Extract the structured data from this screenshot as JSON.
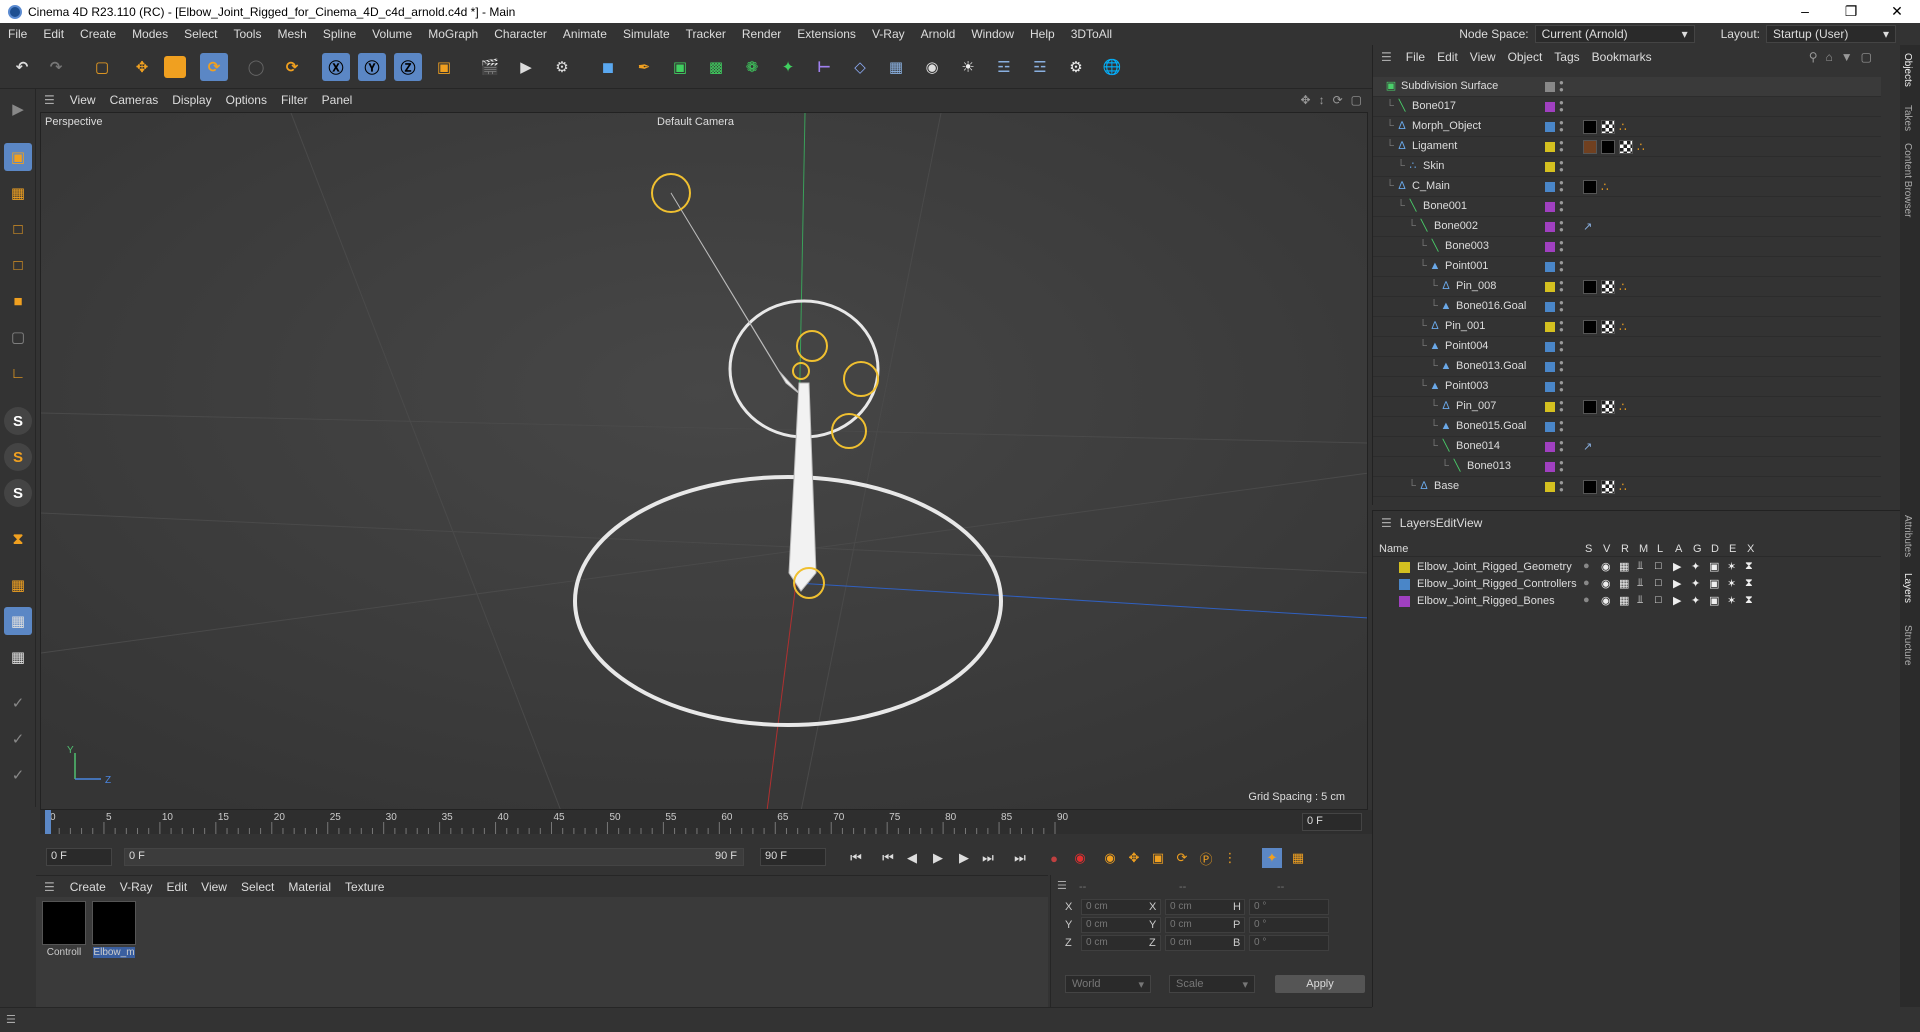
{
  "window": {
    "title": "Cinema 4D R23.110 (RC) - [Elbow_Joint_Rigged_for_Cinema_4D_c4d_arnold.c4d *] - Main"
  },
  "menu": {
    "items": [
      "File",
      "Edit",
      "Create",
      "Modes",
      "Select",
      "Tools",
      "Mesh",
      "Spline",
      "Volume",
      "MoGraph",
      "Character",
      "Animate",
      "Simulate",
      "Tracker",
      "Render",
      "Extensions",
      "V-Ray",
      "Arnold",
      "Window",
      "Help",
      "3DToAll"
    ],
    "node_space_label": "Node Space:",
    "node_space_value": "Current (Arnold)",
    "layout_label": "Layout:",
    "layout_value": "Startup (User)"
  },
  "viewport_menu": [
    "View",
    "Cameras",
    "Display",
    "Options",
    "Filter",
    "Panel"
  ],
  "viewport": {
    "label": "Perspective",
    "camera": "Default Camera",
    "grid_spacing": "Grid Spacing : 5 cm",
    "axis_y": "Y",
    "axis_z": "Z"
  },
  "timeline": {
    "ticks": [
      "0",
      "5",
      "10",
      "15",
      "20",
      "25",
      "30",
      "35",
      "40",
      "45",
      "50",
      "55",
      "60",
      "65",
      "70",
      "75",
      "80",
      "85",
      "90"
    ],
    "current_frame": "0 F",
    "start_field": "0 F",
    "range_start": "0 F",
    "range_end": "90 F",
    "end_field": "90 F",
    "right_field": "0 F"
  },
  "material_menu": [
    "Create",
    "V-Ray",
    "Edit",
    "View",
    "Select",
    "Material",
    "Texture"
  ],
  "materials": [
    {
      "name": "Controll"
    },
    {
      "name": "Elbow_m"
    }
  ],
  "coords": {
    "headers": [
      "--",
      "--",
      "--"
    ],
    "rows": [
      {
        "a": "X",
        "av": "0 cm",
        "b": "X",
        "bv": "0 cm",
        "c": "H",
        "cv": "0 °"
      },
      {
        "a": "Y",
        "av": "0 cm",
        "b": "Y",
        "bv": "0 cm",
        "c": "P",
        "cv": "0 °"
      },
      {
        "a": "Z",
        "av": "0 cm",
        "b": "Z",
        "bv": "0 cm",
        "c": "B",
        "cv": "0 °"
      }
    ],
    "world": "World",
    "scale": "Scale",
    "apply": "Apply"
  },
  "object_manager": {
    "menu": [
      "File",
      "Edit",
      "View",
      "Object",
      "Tags",
      "Bookmarks"
    ],
    "objects": [
      {
        "name": "Subdivision Surface",
        "depth": 0,
        "icon": "subdivision-icon",
        "color": "#4ad06a",
        "layer": "#888888"
      },
      {
        "name": "Bone017",
        "depth": 1,
        "icon": "bone-icon",
        "color": "#4ad06a",
        "layer": "#a040c0"
      },
      {
        "name": "Morph_Object",
        "depth": 1,
        "icon": "null-icon",
        "color": "#6aa8e8",
        "layer": "#4a86c8"
      },
      {
        "name": "Ligament",
        "depth": 1,
        "icon": "null-icon",
        "color": "#6aa8e8",
        "layer": "#d4c020"
      },
      {
        "name": "Skin",
        "depth": 2,
        "icon": "skin-icon",
        "color": "#6aa8e8",
        "layer": "#d4c020"
      },
      {
        "name": "C_Main",
        "depth": 1,
        "icon": "null-icon",
        "color": "#6aa8e8",
        "layer": "#4a86c8"
      },
      {
        "name": "Bone001",
        "depth": 2,
        "icon": "bone-icon",
        "color": "#4ad06a",
        "layer": "#a040c0"
      },
      {
        "name": "Bone002",
        "depth": 3,
        "icon": "bone-icon",
        "color": "#4ad06a",
        "layer": "#a040c0"
      },
      {
        "name": "Bone003",
        "depth": 4,
        "icon": "bone-icon",
        "color": "#4ad06a",
        "layer": "#a040c0"
      },
      {
        "name": "Point001",
        "depth": 4,
        "icon": "point-icon",
        "color": "#6aa8e8",
        "layer": "#4a86c8"
      },
      {
        "name": "Pin_008",
        "depth": 5,
        "icon": "null-icon",
        "color": "#6aa8e8",
        "layer": "#d4c020"
      },
      {
        "name": "Bone016.Goal",
        "depth": 5,
        "icon": "point-icon",
        "color": "#6aa8e8",
        "layer": "#4a86c8"
      },
      {
        "name": "Pin_001",
        "depth": 4,
        "icon": "null-icon",
        "color": "#6aa8e8",
        "layer": "#d4c020"
      },
      {
        "name": "Point004",
        "depth": 4,
        "icon": "point-icon",
        "color": "#6aa8e8",
        "layer": "#4a86c8"
      },
      {
        "name": "Bone013.Goal",
        "depth": 5,
        "icon": "point-icon",
        "color": "#6aa8e8",
        "layer": "#4a86c8"
      },
      {
        "name": "Point003",
        "depth": 4,
        "icon": "point-icon",
        "color": "#6aa8e8",
        "layer": "#4a86c8"
      },
      {
        "name": "Pin_007",
        "depth": 5,
        "icon": "null-icon",
        "color": "#6aa8e8",
        "layer": "#d4c020"
      },
      {
        "name": "Bone015.Goal",
        "depth": 5,
        "icon": "point-icon",
        "color": "#6aa8e8",
        "layer": "#4a86c8"
      },
      {
        "name": "Bone014",
        "depth": 5,
        "icon": "bone-icon",
        "color": "#4ad06a",
        "layer": "#a040c0"
      },
      {
        "name": "Bone013",
        "depth": 6,
        "icon": "bone-icon",
        "color": "#4ad06a",
        "layer": "#a040c0"
      },
      {
        "name": "Base",
        "depth": 3,
        "icon": "null-icon",
        "color": "#6aa8e8",
        "layer": "#d4c020"
      }
    ]
  },
  "layers": {
    "menu": [
      "Layers",
      "Edit",
      "View"
    ],
    "header": {
      "name": "Name",
      "cols": [
        "S",
        "V",
        "R",
        "M",
        "L",
        "A",
        "G",
        "D",
        "E",
        "X"
      ]
    },
    "rows": [
      {
        "name": "Elbow_Joint_Rigged_Geometry",
        "color": "#d4c020"
      },
      {
        "name": "Elbow_Joint_Rigged_Controllers",
        "color": "#4a86c8"
      },
      {
        "name": "Elbow_Joint_Rigged_Bones",
        "color": "#a040c0"
      }
    ]
  },
  "right_tabs": [
    "Objects",
    "Takes",
    "Content Browser",
    "Attributes",
    "Layers",
    "Structure"
  ]
}
